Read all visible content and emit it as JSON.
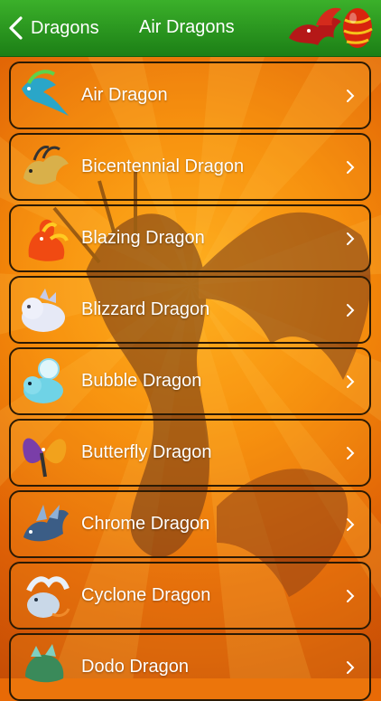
{
  "nav": {
    "back_label": "Dragons",
    "title": "Air Dragons"
  },
  "colors": {
    "nav_green": "#2a9a20",
    "background_orange": "#f08a0a",
    "row_border": "#2c1a04",
    "text": "#ffffff"
  },
  "items": [
    {
      "label": "Air Dragon",
      "icon": "air-dragon-icon",
      "color": "#2aa6c8"
    },
    {
      "label": "Bicentennial Dragon",
      "icon": "bicentennial-dragon-icon",
      "color": "#d9b04a"
    },
    {
      "label": "Blazing Dragon",
      "icon": "blazing-dragon-icon",
      "color": "#f04a12"
    },
    {
      "label": "Blizzard Dragon",
      "icon": "blizzard-dragon-icon",
      "color": "#e6e9f6"
    },
    {
      "label": "Bubble Dragon",
      "icon": "bubble-dragon-icon",
      "color": "#6fd3e6"
    },
    {
      "label": "Butterfly Dragon",
      "icon": "butterfly-dragon-icon",
      "color": "#7a3ea8"
    },
    {
      "label": "Chrome Dragon",
      "icon": "chrome-dragon-icon",
      "color": "#3b5d86"
    },
    {
      "label": "Cyclone Dragon",
      "icon": "cyclone-dragon-icon",
      "color": "#c9d8e8"
    },
    {
      "label": "Dodo Dragon",
      "icon": "dodo-dragon-icon",
      "color": "#3a8a5a"
    }
  ]
}
